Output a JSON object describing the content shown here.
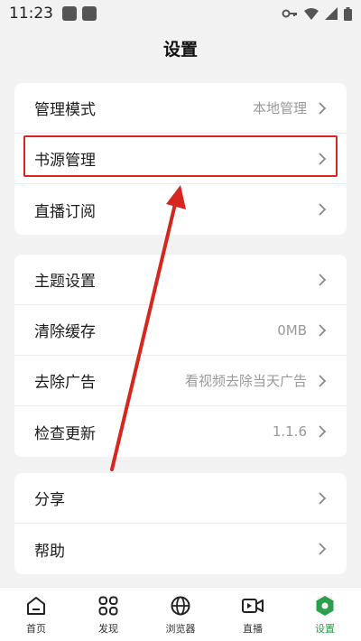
{
  "status": {
    "time": "11:23"
  },
  "page": {
    "title": "设置"
  },
  "group1": [
    {
      "label": "管理模式",
      "value": "本地管理"
    },
    {
      "label": "书源管理",
      "value": ""
    },
    {
      "label": "直播订阅",
      "value": ""
    }
  ],
  "group2": [
    {
      "label": "主题设置",
      "value": ""
    },
    {
      "label": "清除缓存",
      "value": "0MB"
    },
    {
      "label": "去除广告",
      "value": "看视频去除当天广告"
    },
    {
      "label": "检查更新",
      "value": "1.1.6"
    }
  ],
  "group3": [
    {
      "label": "分享",
      "value": ""
    },
    {
      "label": "帮助",
      "value": ""
    }
  ],
  "tabs": [
    {
      "label": "首页",
      "icon": "home-icon"
    },
    {
      "label": "发现",
      "icon": "grid-icon"
    },
    {
      "label": "浏览器",
      "icon": "globe-icon"
    },
    {
      "label": "直播",
      "icon": "video-icon"
    },
    {
      "label": "设置",
      "icon": "settings-hex-icon",
      "active": true
    }
  ],
  "colors": {
    "accent": "#2aa04a",
    "highlight": "#d7261e"
  }
}
